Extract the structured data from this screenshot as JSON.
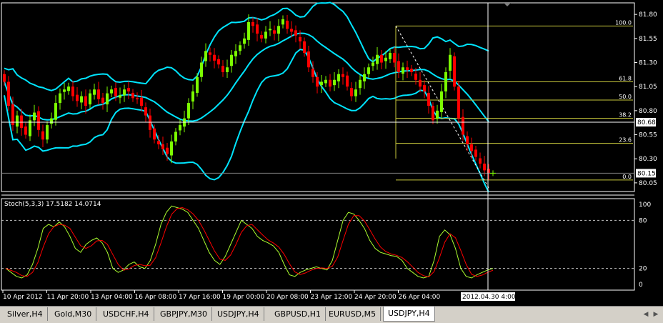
{
  "chart_data": [
    {
      "type": "candlestick",
      "symbol": "USDJPY",
      "timeframe": "H4",
      "ylim": [
        79.96,
        81.92
      ],
      "price_ticks": [
        "81.80",
        "81.55",
        "81.30",
        "81.05",
        "80.80",
        "80.55",
        "80.30",
        "80.05"
      ],
      "price_tick_values": [
        81.8,
        81.55,
        81.3,
        81.05,
        80.8,
        80.55,
        80.3,
        80.05
      ],
      "current_price_label": "80.15",
      "current_price": 80.15,
      "crosshair_price_label": "80.68",
      "crosshair_price": 80.68,
      "x_labels": [
        "10 Apr 2012",
        "11 Apr 20:00",
        "13 Apr 04:00",
        "16 Apr 08:00",
        "17 Apr 16:00",
        "19 Apr 00:00",
        "20 Apr 08:00",
        "23 Apr 12:00",
        "24 Apr 20:00",
        "26 Apr 04:00"
      ],
      "crosshair_time_label": "2012.04.30 4:00",
      "bollinger_color": "#00e5ff",
      "bull_color": "#7cfc00",
      "bear_color": "#ff0000",
      "fibonacci": {
        "color": "#c8c83c",
        "levels": [
          {
            "label": "100.0",
            "price": 81.68
          },
          {
            "label": "61.8",
            "price": 81.1
          },
          {
            "label": "50.0",
            "price": 80.91
          },
          {
            "label": "38.2",
            "price": 80.72
          },
          {
            "label": "23.6",
            "price": 80.46
          },
          {
            "label": "0.0",
            "price": 80.08
          }
        ]
      },
      "close": [
        81.1,
        80.85,
        80.65,
        80.75,
        80.62,
        80.55,
        80.7,
        80.78,
        80.6,
        80.5,
        80.65,
        80.72,
        80.88,
        80.98,
        81.02,
        81.05,
        80.95,
        80.9,
        80.95,
        80.85,
        80.98,
        81.02,
        80.92,
        80.88,
        80.98,
        81.02,
        80.95,
        80.96,
        81.02,
        81.0,
        80.93,
        80.92,
        80.85,
        80.75,
        80.6,
        80.5,
        80.45,
        80.4,
        80.35,
        80.48,
        80.58,
        80.65,
        80.72,
        80.88,
        81.0,
        81.15,
        81.3,
        81.42,
        81.38,
        81.32,
        81.28,
        81.2,
        81.25,
        81.38,
        81.42,
        81.48,
        81.55,
        81.72,
        81.68,
        81.6,
        81.55,
        81.62,
        81.65,
        81.6,
        81.68,
        81.75,
        81.65,
        81.62,
        81.58,
        81.52,
        81.4,
        81.25,
        81.15,
        81.05,
        81.1,
        81.12,
        81.05,
        81.12,
        81.18,
        81.15,
        81.05,
        80.95,
        81.02,
        81.12,
        81.18,
        81.25,
        81.3,
        81.38,
        81.3,
        81.35,
        81.4,
        81.3,
        81.2,
        81.25,
        81.22,
        81.2,
        81.12,
        81.05,
        81.0,
        80.85,
        80.7,
        80.8,
        81.0,
        81.2,
        81.38,
        81.05,
        80.72,
        80.55,
        80.45,
        80.38,
        80.32,
        80.25,
        80.18,
        80.15
      ],
      "stoch_ticks": [
        "100",
        "80",
        "20",
        "0"
      ],
      "stoch_tick_values": [
        100,
        80,
        20,
        0
      ],
      "stoch_label": "Stoch(5,3,3) 17.5182 14.0714",
      "stoch_k_color": "#adff2f",
      "stoch_d_color": "#ff0000",
      "stoch_k": [
        20,
        15,
        10,
        8,
        12,
        25,
        45,
        70,
        75,
        72,
        78,
        72,
        60,
        45,
        40,
        50,
        55,
        58,
        52,
        40,
        20,
        15,
        18,
        25,
        28,
        22,
        20,
        30,
        50,
        75,
        90,
        98,
        96,
        94,
        90,
        80,
        70,
        55,
        40,
        30,
        25,
        35,
        50,
        65,
        80,
        75,
        70,
        60,
        55,
        52,
        48,
        40,
        25,
        12,
        10,
        15,
        18,
        20,
        22,
        20,
        18,
        30,
        55,
        80,
        90,
        88,
        80,
        70,
        55,
        45,
        40,
        38,
        36,
        35,
        30,
        20,
        15,
        10,
        8,
        10,
        30,
        60,
        68,
        62,
        45,
        20,
        10,
        8,
        12,
        15,
        18,
        20
      ]
    }
  ],
  "tabs": [
    {
      "label": "Silver,H4"
    },
    {
      "label": "Gold,M30"
    },
    {
      "label": "USDCHF,H4"
    },
    {
      "label": "GBPJPY,M30"
    },
    {
      "label": "USDJPY,H4"
    },
    {
      "label": "GBPUSD,H1"
    },
    {
      "label": "EURUSD,M5"
    },
    {
      "label": "USDJPY,H4"
    }
  ],
  "active_tab": 7,
  "nav": {
    "left_icon": "triangle-left-icon",
    "right_icon": "triangle-right-icon"
  }
}
